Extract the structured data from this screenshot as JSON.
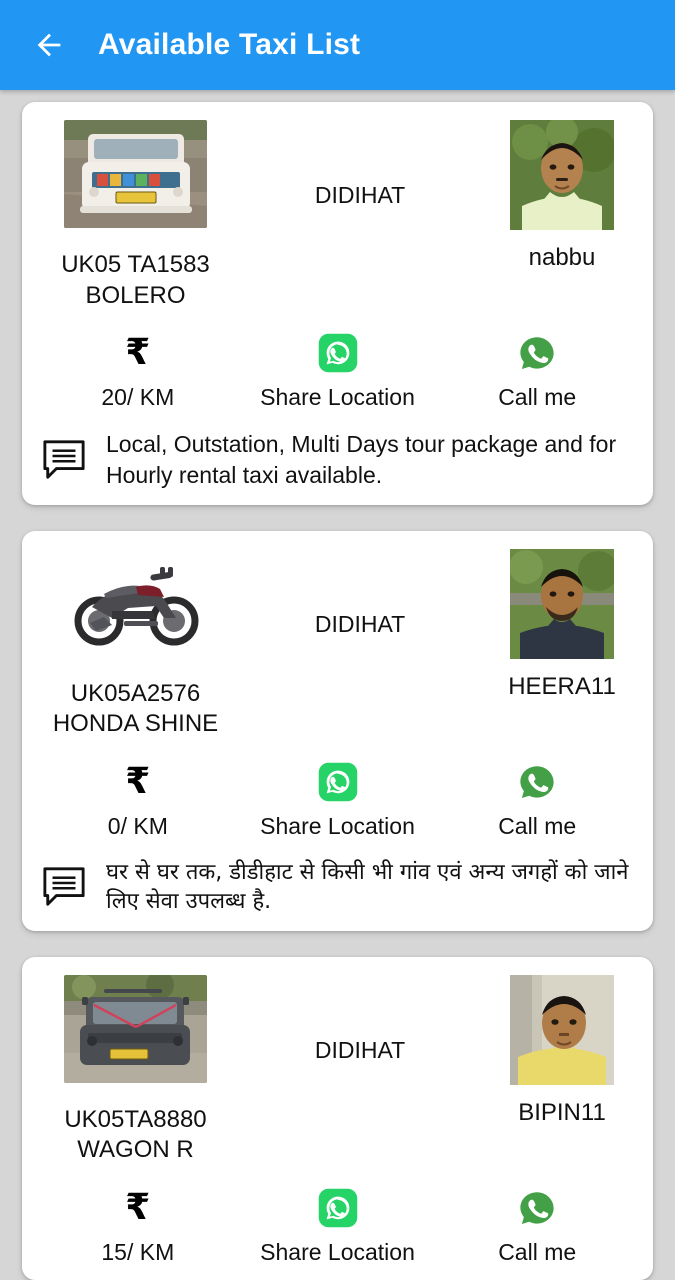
{
  "header": {
    "back_icon": "arrow-left-icon",
    "title": "Available Taxi List",
    "background_color": "#2196f3"
  },
  "theme": {
    "page_background": "#d6d6d6",
    "card_background": "#ffffff",
    "whatsapp_green": "#25d366",
    "call_green": "#43a047",
    "text_color": "#111111"
  },
  "labels": {
    "share_location": "Share Location",
    "call_me": "Call me",
    "rupee_symbol": "₹",
    "whatsapp_icon": "whatsapp-icon",
    "call_icon": "phone-bubble-icon",
    "message_icon": "message-icon"
  },
  "cards": [
    {
      "vehicle_number": "UK05 TA1583",
      "vehicle_model": "BOLERO",
      "vehicle_label": "UK05 TA1583\nBOLERO",
      "city": "DIDIHAT",
      "driver_name": "nabbu",
      "rate": "20/ KM",
      "description": "Local, Outstation, Multi Days tour package and for Hourly rental taxi available.",
      "vehicle_photo": "white-bolero-suv-photo",
      "driver_photo": "driver-portrait-nabbu"
    },
    {
      "vehicle_number": "UK05A2576",
      "vehicle_model": "HONDA SHINE",
      "vehicle_label": "UK05A2576\nHONDA SHINE",
      "city": "DIDIHAT",
      "driver_name": "HEERA11",
      "rate": "0/ KM",
      "description": "घर से घर तक, डीडीहाट से किसी भी गांव एवं अन्य जगहों को जाने लिए सेवा उपलब्ध है.",
      "vehicle_photo": "grey-honda-shine-motorcycle-photo",
      "driver_photo": "driver-portrait-heera11"
    },
    {
      "vehicle_number": "UK05TA8880",
      "vehicle_model": "WAGON R",
      "vehicle_label": "UK05TA8880\nWAGON R",
      "city": "DIDIHAT",
      "driver_name": "BIPIN11",
      "rate": "15/ KM",
      "description": "",
      "vehicle_photo": "grey-wagonr-car-photo",
      "driver_photo": "driver-portrait-bipin11"
    }
  ]
}
